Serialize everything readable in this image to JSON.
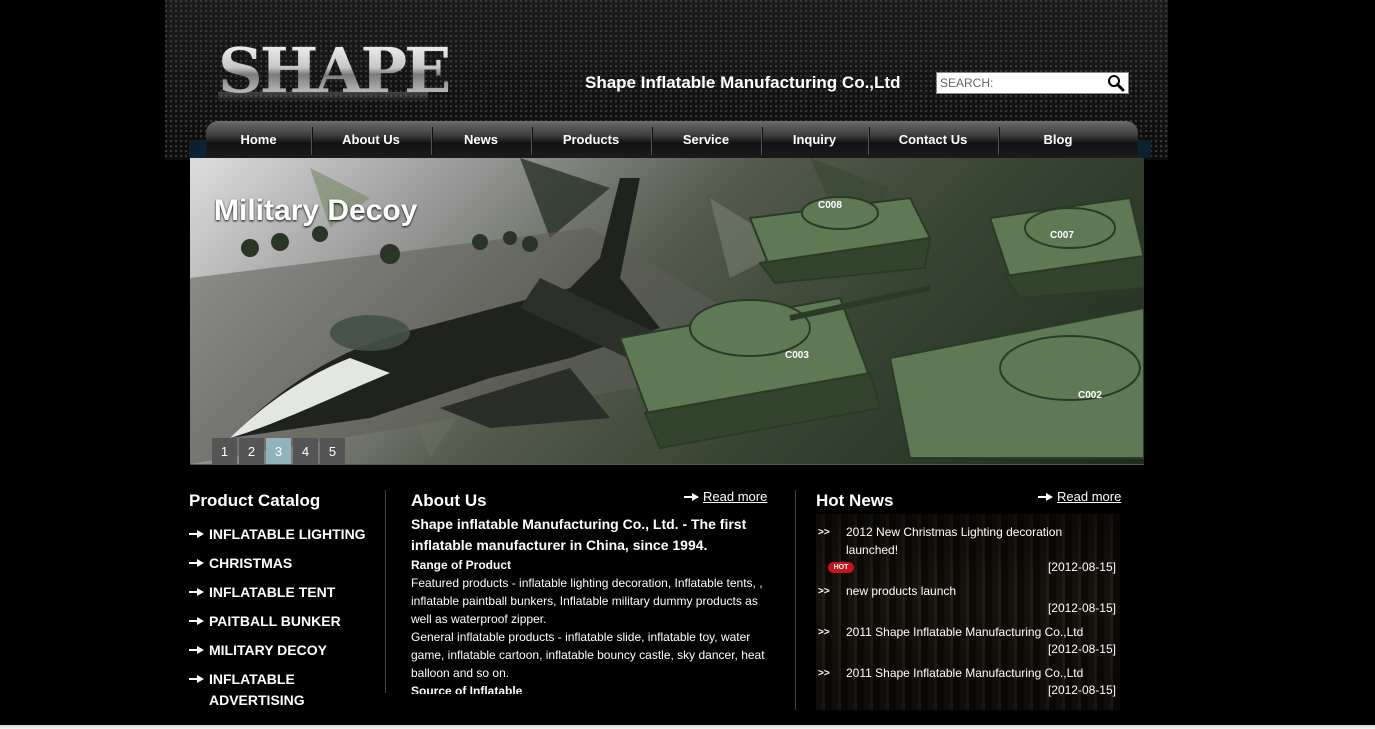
{
  "header": {
    "logo_text": "SHAPE",
    "company_name": "Shape Inflatable Manufacturing Co.,Ltd",
    "search_placeholder": "SEARCH:",
    "search_icon": "search-icon"
  },
  "nav": {
    "items": [
      {
        "label": "Home"
      },
      {
        "label": "About Us"
      },
      {
        "label": "News"
      },
      {
        "label": "Products"
      },
      {
        "label": "Service"
      },
      {
        "label": "Inquiry"
      },
      {
        "label": "Contact Us"
      },
      {
        "label": "Blog"
      }
    ]
  },
  "banner": {
    "title": "Military Decoy",
    "slides": [
      "1",
      "2",
      "3",
      "4",
      "5"
    ],
    "active_slide": 3,
    "tank_labels": [
      "C008",
      "C007",
      "C003",
      "C002"
    ]
  },
  "catalog": {
    "title": "Product Catalog",
    "items": [
      {
        "label": "INFLATABLE LIGHTING"
      },
      {
        "label": "CHRISTMAS"
      },
      {
        "label": "INFLATABLE TENT"
      },
      {
        "label": "PAITBALL BUNKER"
      },
      {
        "label": "MILITARY DECOY"
      },
      {
        "label": "INFLATABLE ADVERTISING"
      }
    ]
  },
  "about": {
    "title": "About Us",
    "read_more": "Read more",
    "headline": "Shape inflatable Manufacturing Co., Ltd. - The first inflatable manufacturer in China, since 1994.",
    "range_title": "Range of Product",
    "featured": "Featured products - inflatable lighting decoration, Inflatable tents, , inflatable paintball bunkers, Inflatable military dummy products as well as waterproof zipper.",
    "general": "General inflatable products - inflatable slide, inflatable toy, water game, inflatable cartoon, inflatable bouncy castle, sky dancer, heat balloon and so on.",
    "source_title": "Source of Inflatable"
  },
  "news": {
    "title": "Hot News",
    "read_more": "Read more",
    "bullet": ">>",
    "hot_badge": "HOT",
    "items": [
      {
        "title": "2012 New Christmas Lighting decoration launched!",
        "date": "[2012-08-15]"
      },
      {
        "title": "new products launch",
        "date": "[2012-08-15]"
      },
      {
        "title": "2011 Shape Inflatable Manufacturing Co.,Ltd",
        "date": "[2012-08-15]"
      },
      {
        "title": "2011 Shape Inflatable Manufacturing Co.,Ltd",
        "date": "[2012-08-15]"
      }
    ]
  },
  "colors": {
    "background": "#000000",
    "active_slide": "#8fb4bd",
    "hot_badge": "#c8141b"
  }
}
